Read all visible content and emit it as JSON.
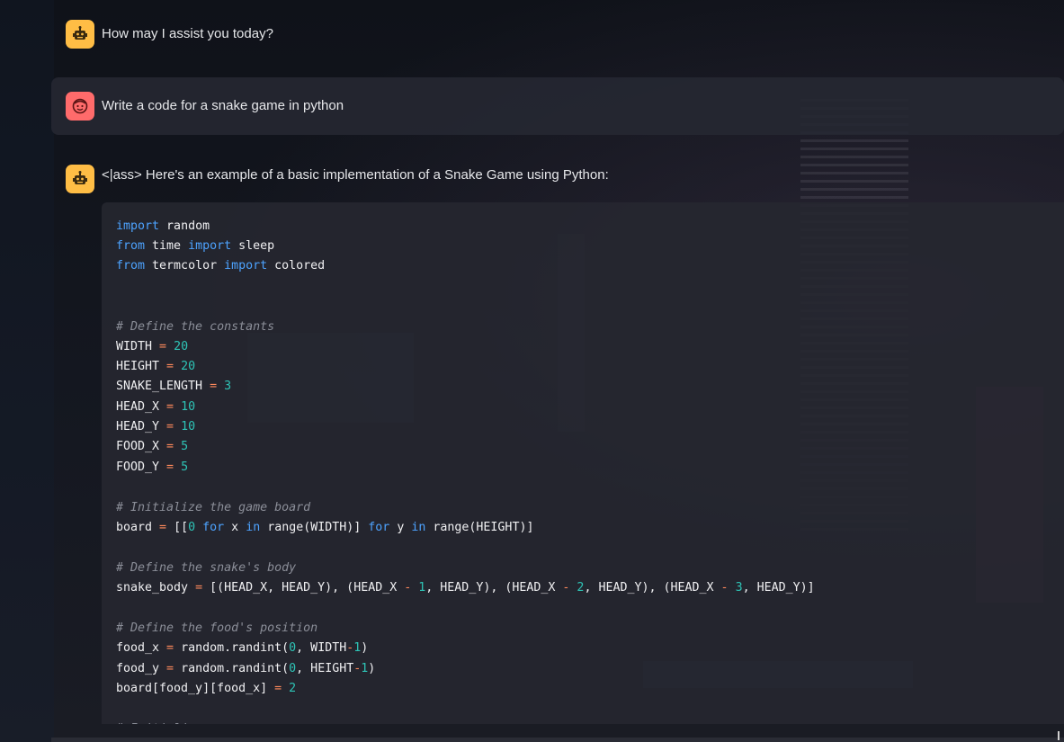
{
  "messages": [
    {
      "role": "assistant",
      "avatar": "robot-icon",
      "text": "How may I assist you today?"
    },
    {
      "role": "user",
      "avatar": "smiley-face-icon",
      "text": "Write a code for a snake game in python"
    },
    {
      "role": "assistant",
      "avatar": "robot-icon",
      "text": "<|ass> Here's an example of a basic implementation of a Snake Game using Python:"
    }
  ],
  "code": {
    "language": "python",
    "lines": [
      "import random",
      "from time import sleep",
      "from termcolor import colored",
      "",
      "# Define the constants",
      "WIDTH = 20",
      "HEIGHT = 20",
      "SNAKE_LENGTH = 3",
      "HEAD_X = 10",
      "HEAD_Y = 10",
      "FOOD_X = 5",
      "FOOD_Y = 5",
      "",
      "# Initialize the game board",
      "board = [[0 for x in range(WIDTH)] for y in range(HEIGHT)]",
      "",
      "# Define the snake's body",
      "snake_body = [(HEAD_X, HEAD_Y), (HEAD_X - 1, HEAD_Y), (HEAD_X - 2, HEAD_Y), (HEAD_X - 3, HEAD_Y)]",
      "",
      "# Define the food's position",
      "food_x = random.randint(0, WIDTH-1)",
      "food_y = random.randint(0, HEIGHT-1)",
      "board[food_y][food_x] = 2",
      "",
      "# Initialize"
    ]
  },
  "colors": {
    "assistant_avatar": "#ffbd45",
    "user_avatar": "#ff6b6b",
    "keyword": "#4da3ff",
    "number": "#2ec4b6",
    "operator": "#ff8a5c",
    "comment": "#8b8e98"
  }
}
